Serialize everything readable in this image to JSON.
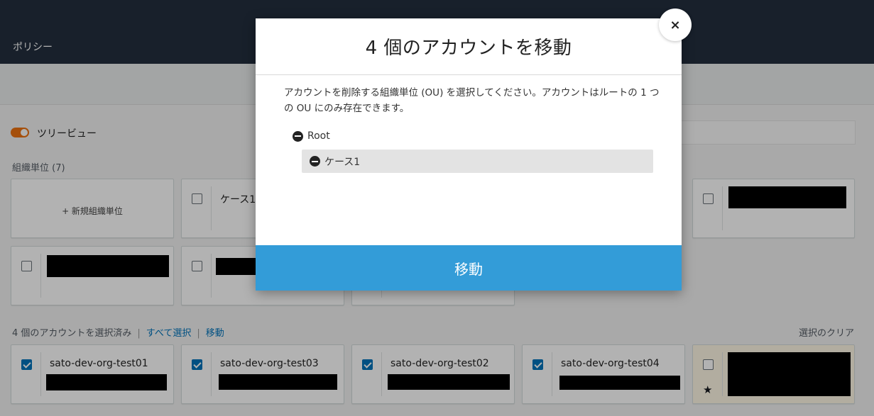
{
  "header": {
    "breadcrumb": "ポリシー"
  },
  "view": {
    "tree_view_label": "ツリービュー"
  },
  "ou_section": {
    "label": "組織単位 (7)",
    "new_ou_label": "+ 新規組織単位",
    "visible_ou_name_partial": "ケース1"
  },
  "accounts_bar": {
    "selected_text": "4 個のアカウントを選択済み",
    "select_all": "すべて選択",
    "move": "移動",
    "clear_selection": "選択のクリア"
  },
  "accounts": [
    {
      "name": "sato-dev-org-test01",
      "checked": true
    },
    {
      "name": "sato-dev-org-test03",
      "checked": true
    },
    {
      "name": "sato-dev-org-test02",
      "checked": true
    },
    {
      "name": "sato-dev-org-test04",
      "checked": true
    }
  ],
  "modal": {
    "title": "4 個のアカウントを移動",
    "description": "アカウントを削除する組織単位 (OU) を選択してください。アカウントはルートの 1 つの OU にのみ存在できます。",
    "tree": {
      "root_label": "Root",
      "child_label": "ケース1"
    },
    "move_button": "移動",
    "close_symbol": "×"
  },
  "colors": {
    "topbar": "#232f3e",
    "primary_button": "#339cd8",
    "link": "#0073bb",
    "toggle": "#ec7211"
  },
  "icons": [
    "minus-circle-icon",
    "close-icon",
    "star-icon",
    "checkbox-checked",
    "checkbox-unchecked"
  ]
}
